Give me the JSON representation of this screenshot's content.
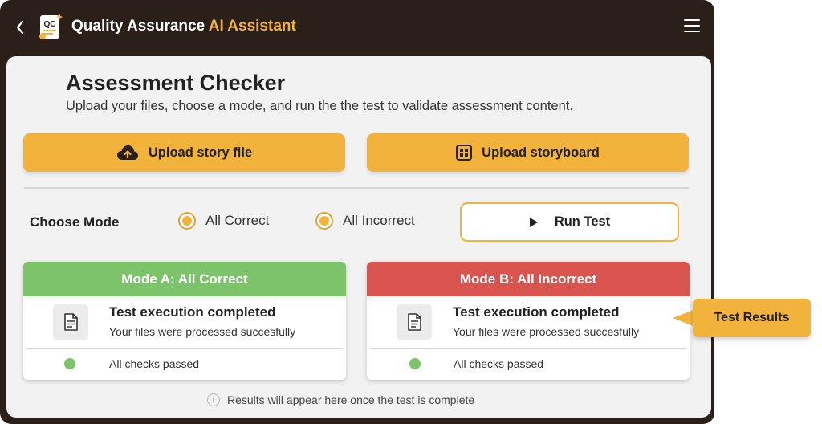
{
  "app": {
    "title_main": "Quality Assurance",
    "title_accent": "AI Assistant",
    "logo_text": "QC",
    "accent_color": "#f2b33d",
    "header_bg": "#2b2019"
  },
  "page": {
    "title": "Assessment Checker",
    "subtitle": "Upload your files, choose a mode, and run the the test to validate assessment content."
  },
  "uploads": {
    "story_label": "Upload story file",
    "storyboard_label": "Upload storyboard"
  },
  "mode": {
    "label": "Choose Mode",
    "options": [
      {
        "label": "All Correct",
        "selected": true
      },
      {
        "label": "All Incorrect",
        "selected": true
      }
    ],
    "run_label": "Run Test"
  },
  "results": [
    {
      "header": "Mode A: All Correct",
      "header_color": "#7cc36a",
      "message_title": "Test execution completed",
      "message_sub": "Your files were processed succesfully",
      "status": "All checks passed",
      "status_color": "#7cc36a"
    },
    {
      "header": "Mode B: All Incorrect",
      "header_color": "#d9544e",
      "message_title": "Test execution completed",
      "message_sub": "Your files were processed succesfully",
      "status": "All checks passed",
      "status_color": "#7cc36a"
    }
  ],
  "footnote": "Results will appear here once the test is complete",
  "callout": "Test Results",
  "icons": {
    "back": "chevron-left-icon",
    "menu": "hamburger-menu-icon",
    "upload": "cloud-upload-icon",
    "storyboard": "grid-icon",
    "run": "play-icon",
    "document": "document-icon",
    "info": "info-icon"
  }
}
